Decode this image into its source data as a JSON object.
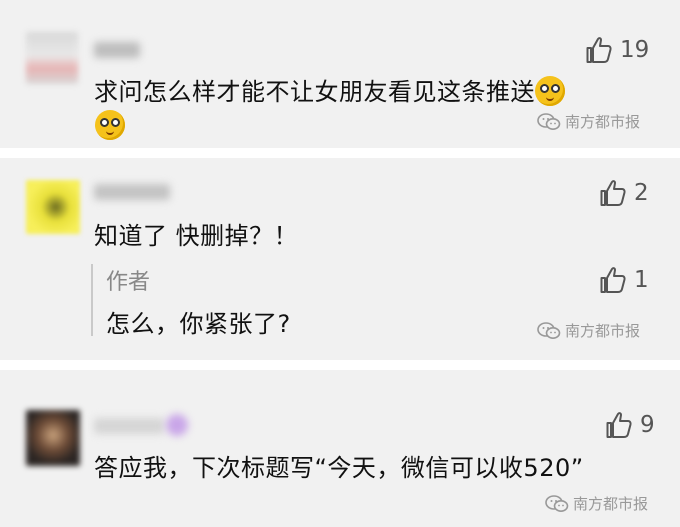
{
  "source": "南方都市报",
  "comments": [
    {
      "likes": "19",
      "text": "求问怎么样才能不让女朋友看见这条推送"
    },
    {
      "likes": "2",
      "text": "知道了 快删掉？！",
      "reply": {
        "author_label": "作者",
        "likes": "1",
        "text": "怎么，你紧张了?"
      }
    },
    {
      "likes": "9",
      "text": "答应我，下次标题写“今天，微信可以收520”"
    }
  ]
}
